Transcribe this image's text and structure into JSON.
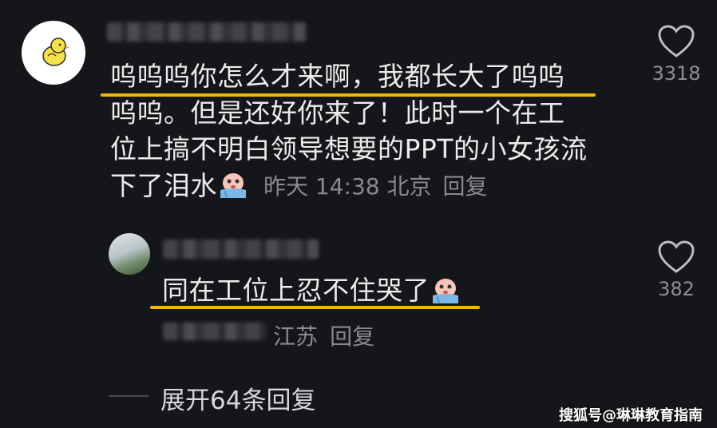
{
  "comment": {
    "lines": [
      "呜呜呜你怎么才来啊，我都长大了呜呜",
      "呜呜。但是还好你来了！此时一个在工",
      "位上搞不明白领导想要的PPT的小女孩流",
      "下了泪水"
    ],
    "time": "昨天 14:38 北京",
    "reply": "回复",
    "likes": "3318",
    "username": "用户昵称"
  },
  "reply_comment": {
    "text": "同在工位上忍不住哭了",
    "location": "江苏",
    "reply": "回复",
    "likes": "382"
  },
  "expand": {
    "label": "展开64条回复"
  },
  "watermark": "搜狐号@琳琳教育指南",
  "colors": {
    "background": "#15161a",
    "underline": "#f2b705",
    "meta": "#8a8a8e"
  },
  "icons": [
    "chick-avatar",
    "heart-icon",
    "crying-emoji"
  ]
}
